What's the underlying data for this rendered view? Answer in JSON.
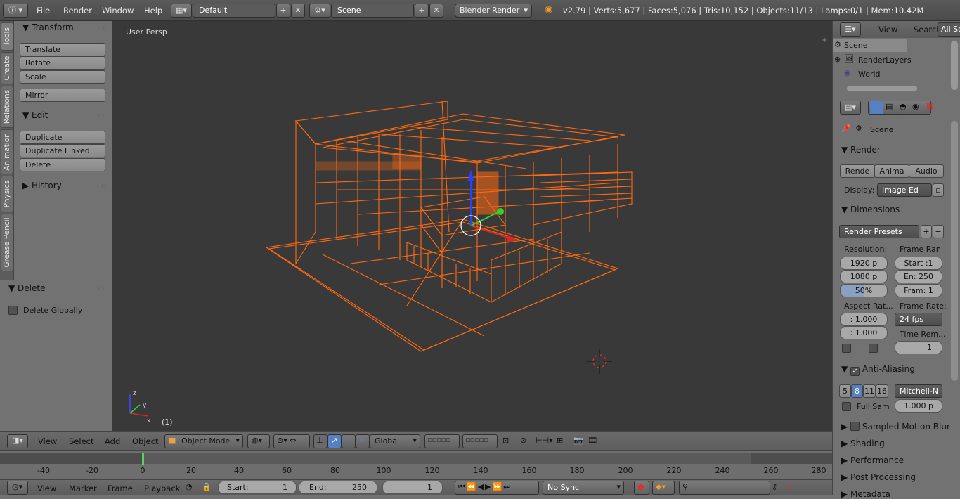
{
  "topbar": {
    "menus": [
      "File",
      "Render",
      "Window",
      "Help"
    ],
    "layout": "Default",
    "scene": "Scene",
    "engine": "Blender Render",
    "stats": "v2.79 | Verts:5,677 | Faces:5,076 | Tris:10,152 | Objects:11/13 | Lamps:0/1 | Mem:10.42M"
  },
  "tabs": [
    "Tools",
    "Create",
    "Relations",
    "Animation",
    "Physics",
    "Grease Pencil"
  ],
  "tools": {
    "transform_title": "Transform",
    "translate": "Translate",
    "rotate": "Rotate",
    "scale": "Scale",
    "mirror": "Mirror",
    "edit_title": "Edit",
    "duplicate": "Duplicate",
    "duplicate_linked": "Duplicate Linked",
    "delete": "Delete",
    "history_title": "History"
  },
  "operator": {
    "title": "Delete",
    "delete_globally": "Delete Globally"
  },
  "viewport": {
    "view_name": "User Persp",
    "frame_label": "(1)",
    "wire_color": "#ff6a13"
  },
  "header3d": {
    "menus": [
      "View",
      "Select",
      "Add",
      "Object"
    ],
    "mode": "Object Mode",
    "orientation": "Global"
  },
  "timeline": {
    "ticks": [
      "-40",
      "-20",
      "0",
      "20",
      "40",
      "60",
      "80",
      "100",
      "120",
      "140",
      "160",
      "180",
      "200",
      "220",
      "240",
      "260",
      "280"
    ],
    "menus": [
      "View",
      "Marker",
      "Frame",
      "Playback"
    ],
    "start_label": "Start:",
    "start_value": "1",
    "end_label": "End:",
    "end_value": "250",
    "current": "1",
    "sync": "No Sync"
  },
  "outliner": {
    "menus": [
      "View",
      "Search"
    ],
    "filter": "All Sc",
    "items": [
      "Scene",
      "RenderLayers",
      "World"
    ]
  },
  "props": {
    "context": "Scene",
    "render_title": "Render",
    "render_btns": [
      "Rende",
      "Anima",
      "Audio"
    ],
    "display_label": "Display:",
    "display_value": "Image Ed",
    "dimensions_title": "Dimensions",
    "presets": "Render Presets",
    "resolution_label": "Resolution:",
    "frame_range_label": "Frame Ran",
    "res_x": "1920 p",
    "res_y": "1080 p",
    "res_pct": "50%",
    "start": "Start :1",
    "end": "En: 250",
    "step": "Fram: 1",
    "aspect_label": "Aspect Rat...",
    "framerate_label": "Frame Rate:",
    "aspect_x": ": 1.000",
    "aspect_y": ": 1.000",
    "fps": "24 fps",
    "time_remap_label": "Time Rem...",
    "remap_value": "1",
    "aa_title": "Anti-Aliasing",
    "aa_samples": [
      "5",
      "8",
      "11",
      "16"
    ],
    "filter": "Mitchell-N",
    "full_sample": "Full Sam",
    "filter_size": "1.000 p",
    "sampled_motion_blur": "Sampled Motion Blur",
    "shading": "Shading",
    "performance": "Performance",
    "post_processing": "Post Processing",
    "metadata": "Metadata"
  }
}
